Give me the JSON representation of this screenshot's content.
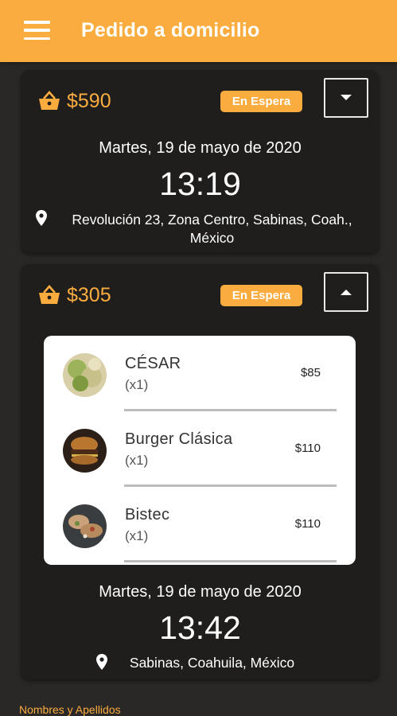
{
  "appbar": {
    "title": "Pedido a domicilio",
    "menu_icon": "hamburger-menu-icon",
    "background": "#fbac3f"
  },
  "orders": [
    {
      "total": "$590",
      "status": "En Espera",
      "expanded": false,
      "date": "Martes, 19 de mayo de 2020",
      "time": "13:19",
      "address_line1": "Revolución 23, Zona Centro, Sabinas, Coah.,",
      "address_line2": "México"
    },
    {
      "total": "$305",
      "status": "En Espera",
      "expanded": true,
      "items": [
        {
          "name": "CÉSAR",
          "qty": "(x1)",
          "price": "$85",
          "image": "caesar-salad"
        },
        {
          "name": "Burger Clásica",
          "qty": "(x1)",
          "price": "$110",
          "image": "burger"
        },
        {
          "name": "Bistec",
          "qty": "(x1)",
          "price": "$110",
          "image": "bistec-tacos"
        }
      ],
      "date": "Martes, 19 de mayo de 2020",
      "time": "13:42",
      "address_line1": "Sabinas, Coahuila, México"
    }
  ],
  "footer": {
    "field_label": "Nombres y Apellidos"
  },
  "colors": {
    "accent": "#fbac3f",
    "card": "#1f1e1d",
    "background": "#2a2827"
  }
}
